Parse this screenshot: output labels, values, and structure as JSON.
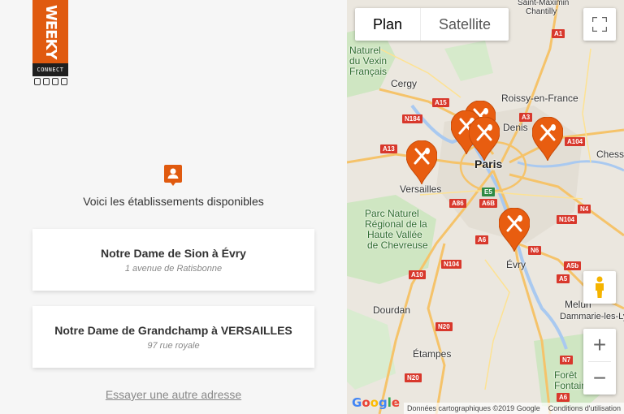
{
  "logo": {
    "text": "WEEKY",
    "sub": "CONNECT"
  },
  "intro": "Voici les établissements disponibles",
  "establishments": [
    {
      "name": "Notre Dame de Sion à Évry",
      "address": "1 avenue de Ratisbonne"
    },
    {
      "name": "Notre Dame de Grandchamp à VERSAILLES",
      "address": "97 rue royale"
    }
  ],
  "retry_label": "Essayer une autre adresse",
  "map": {
    "type_buttons": {
      "plan": "Plan",
      "satellite": "Satellite"
    },
    "places": {
      "paris": "Paris",
      "versailles": "Versailles",
      "cergy": "Cergy",
      "evry": "Évry",
      "etampes": "Étampes",
      "dourdan": "Dourdan",
      "melun": "Melun",
      "dammarie": "Dammarie-les-Lys",
      "roissy": "Roissy-en-France",
      "denis": "Denis",
      "chess": "Chess",
      "saint_maximin": "Saint-Maximin",
      "chantilly": "Chantilly",
      "vexin_1": "Naturel",
      "vexin_2": "du Vexin",
      "vexin_3": "Français",
      "chevreuse_1": "Parc Naturel",
      "chevreuse_2": "Régional de la",
      "chevreuse_3": "Haute Vallée",
      "chevreuse_4": "de Chevreuse",
      "foret_1": "Forêt",
      "foret_2": "Fontainebl"
    },
    "roads": [
      "A1",
      "A15",
      "N184",
      "A13",
      "A86",
      "E5",
      "A6B",
      "A6",
      "N104",
      "A10",
      "N20",
      "A3",
      "A104",
      "N4",
      "N104",
      "N6",
      "A5b",
      "A5",
      "N7",
      "A6"
    ],
    "attribution": {
      "data": "Données cartographiques ©2019 Google",
      "terms": "Conditions d'utilisation"
    },
    "google_logo": "Google",
    "marker_color": "#e85d10"
  }
}
